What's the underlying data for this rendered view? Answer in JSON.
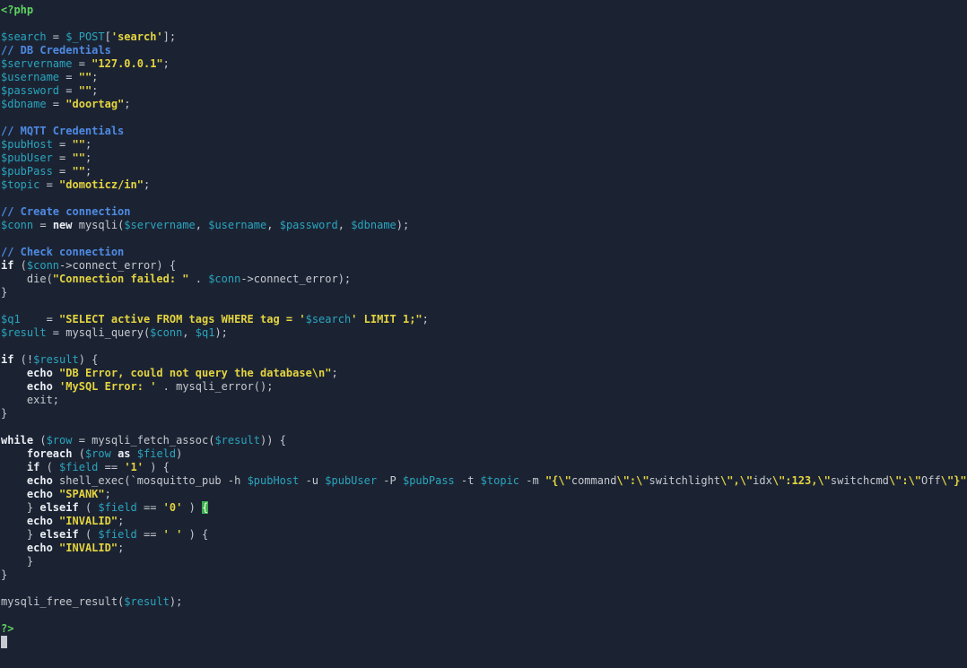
{
  "editor": {
    "colors": {
      "background": "#1b2333",
      "plain": "#c6c9cf",
      "variable": "#2aa5bd",
      "string": "#e4d43f",
      "keyword": "#eaeef3",
      "comment": "#4f8ae3",
      "php_tag": "#5fd35f",
      "bracket_highlight": "#3cb04a"
    },
    "lines": [
      [
        [
          "php",
          "<?php"
        ]
      ],
      [],
      [
        [
          "var",
          "$search"
        ],
        [
          "plain",
          " = "
        ],
        [
          "var",
          "$_POST"
        ],
        [
          "plain",
          "["
        ],
        [
          "str",
          "'search'"
        ],
        [
          "plain",
          "];"
        ]
      ],
      [
        [
          "cmt",
          "// DB Credentials"
        ]
      ],
      [
        [
          "var",
          "$servername"
        ],
        [
          "plain",
          " = "
        ],
        [
          "str",
          "\"127.0.0.1\""
        ],
        [
          "plain",
          ";"
        ]
      ],
      [
        [
          "var",
          "$username"
        ],
        [
          "plain",
          " = "
        ],
        [
          "str",
          "\"\""
        ],
        [
          "plain",
          ";"
        ]
      ],
      [
        [
          "var",
          "$password"
        ],
        [
          "plain",
          " = "
        ],
        [
          "str",
          "\"\""
        ],
        [
          "plain",
          ";"
        ]
      ],
      [
        [
          "var",
          "$dbname"
        ],
        [
          "plain",
          " = "
        ],
        [
          "str",
          "\"doortag\""
        ],
        [
          "plain",
          ";"
        ]
      ],
      [],
      [
        [
          "cmt",
          "// MQTT Credentials"
        ]
      ],
      [
        [
          "var",
          "$pubHost"
        ],
        [
          "plain",
          " = "
        ],
        [
          "str",
          "\"\""
        ],
        [
          "plain",
          ";"
        ]
      ],
      [
        [
          "var",
          "$pubUser"
        ],
        [
          "plain",
          " = "
        ],
        [
          "str",
          "\"\""
        ],
        [
          "plain",
          ";"
        ]
      ],
      [
        [
          "var",
          "$pubPass"
        ],
        [
          "plain",
          " = "
        ],
        [
          "str",
          "\"\""
        ],
        [
          "plain",
          ";"
        ]
      ],
      [
        [
          "var",
          "$topic"
        ],
        [
          "plain",
          " = "
        ],
        [
          "str",
          "\"domoticz/in\""
        ],
        [
          "plain",
          ";"
        ]
      ],
      [],
      [
        [
          "cmt",
          "// Create connection"
        ]
      ],
      [
        [
          "var",
          "$conn"
        ],
        [
          "plain",
          " = "
        ],
        [
          "kw",
          "new"
        ],
        [
          "plain",
          " mysqli("
        ],
        [
          "var",
          "$servername"
        ],
        [
          "plain",
          ", "
        ],
        [
          "var",
          "$username"
        ],
        [
          "plain",
          ", "
        ],
        [
          "var",
          "$password"
        ],
        [
          "plain",
          ", "
        ],
        [
          "var",
          "$dbname"
        ],
        [
          "plain",
          ");"
        ]
      ],
      [],
      [
        [
          "cmt",
          "// Check connection"
        ]
      ],
      [
        [
          "kw",
          "if"
        ],
        [
          "plain",
          " ("
        ],
        [
          "var",
          "$conn"
        ],
        [
          "plain",
          "->connect_error) {"
        ]
      ],
      [
        [
          "plain",
          "    die("
        ],
        [
          "str",
          "\"Connection failed: \""
        ],
        [
          "plain",
          " . "
        ],
        [
          "var",
          "$conn"
        ],
        [
          "plain",
          "->connect_error);"
        ]
      ],
      [
        [
          "plain",
          "}"
        ]
      ],
      [],
      [
        [
          "var",
          "$q1"
        ],
        [
          "plain",
          "    = "
        ],
        [
          "str",
          "\"SELECT active FROM tags WHERE tag = '"
        ],
        [
          "var",
          "$search"
        ],
        [
          "str",
          "' LIMIT 1;\""
        ],
        [
          "plain",
          ";"
        ]
      ],
      [
        [
          "var",
          "$result"
        ],
        [
          "plain",
          " = mysqli_query("
        ],
        [
          "var",
          "$conn"
        ],
        [
          "plain",
          ", "
        ],
        [
          "var",
          "$q1"
        ],
        [
          "plain",
          ");"
        ]
      ],
      [],
      [
        [
          "kw",
          "if"
        ],
        [
          "plain",
          " (!"
        ],
        [
          "var",
          "$result"
        ],
        [
          "plain",
          ") {"
        ]
      ],
      [
        [
          "plain",
          "    "
        ],
        [
          "kw",
          "echo"
        ],
        [
          "plain",
          " "
        ],
        [
          "str",
          "\"DB Error, could not query the database\\n\""
        ],
        [
          "plain",
          ";"
        ]
      ],
      [
        [
          "plain",
          "    "
        ],
        [
          "kw",
          "echo"
        ],
        [
          "plain",
          " "
        ],
        [
          "str",
          "'MySQL Error: '"
        ],
        [
          "plain",
          " . mysqli_error();"
        ]
      ],
      [
        [
          "plain",
          "    exit;"
        ]
      ],
      [
        [
          "plain",
          "}"
        ]
      ],
      [],
      [
        [
          "kw",
          "while"
        ],
        [
          "plain",
          " ("
        ],
        [
          "var",
          "$row"
        ],
        [
          "plain",
          " = mysqli_fetch_assoc("
        ],
        [
          "var",
          "$result"
        ],
        [
          "plain",
          ")) {"
        ]
      ],
      [
        [
          "plain",
          "    "
        ],
        [
          "kw",
          "foreach"
        ],
        [
          "plain",
          " ("
        ],
        [
          "var",
          "$row"
        ],
        [
          "plain",
          " "
        ],
        [
          "kw",
          "as"
        ],
        [
          "plain",
          " "
        ],
        [
          "var",
          "$field"
        ],
        [
          "plain",
          ")"
        ]
      ],
      [
        [
          "plain",
          "    "
        ],
        [
          "kw",
          "if"
        ],
        [
          "plain",
          " ( "
        ],
        [
          "var",
          "$field"
        ],
        [
          "plain",
          " == "
        ],
        [
          "str",
          "'1'"
        ],
        [
          "plain",
          " ) {"
        ]
      ],
      [
        [
          "plain",
          "    "
        ],
        [
          "kw",
          "echo"
        ],
        [
          "plain",
          " shell_exec(`mosquitto_pub -h "
        ],
        [
          "var",
          "$pubHost"
        ],
        [
          "plain",
          " -u "
        ],
        [
          "var",
          "$pubUser"
        ],
        [
          "plain",
          " -P "
        ],
        [
          "var",
          "$pubPass"
        ],
        [
          "plain",
          " -t "
        ],
        [
          "var",
          "$topic"
        ],
        [
          "plain",
          " -m "
        ],
        [
          "str",
          "\"{\\\""
        ],
        [
          "plain",
          "command"
        ],
        [
          "str",
          "\\\":\\\""
        ],
        [
          "plain",
          "switchlight"
        ],
        [
          "str",
          "\\\",\\\""
        ],
        [
          "plain",
          "idx"
        ],
        [
          "str",
          "\\\":123,\\\""
        ],
        [
          "plain",
          "switchcmd"
        ],
        [
          "str",
          "\\\":\\\""
        ],
        [
          "plain",
          "Off"
        ],
        [
          "str",
          "\\\"}\""
        ],
        [
          "plain",
          "`);"
        ]
      ],
      [
        [
          "plain",
          "    "
        ],
        [
          "kw",
          "echo"
        ],
        [
          "plain",
          " "
        ],
        [
          "str",
          "\"SPANK\""
        ],
        [
          "plain",
          ";"
        ]
      ],
      [
        [
          "plain",
          "    } "
        ],
        [
          "kw",
          "elseif"
        ],
        [
          "plain",
          " ( "
        ],
        [
          "var",
          "$field"
        ],
        [
          "plain",
          " == "
        ],
        [
          "str",
          "'0'"
        ],
        [
          "plain",
          " ) "
        ],
        [
          "hl",
          "{"
        ]
      ],
      [
        [
          "plain",
          "    "
        ],
        [
          "kw",
          "echo"
        ],
        [
          "plain",
          " "
        ],
        [
          "str",
          "\"INVALID\""
        ],
        [
          "plain",
          ";"
        ]
      ],
      [
        [
          "plain",
          "    } "
        ],
        [
          "kw",
          "elseif"
        ],
        [
          "plain",
          " ( "
        ],
        [
          "var",
          "$field"
        ],
        [
          "plain",
          " == "
        ],
        [
          "str",
          "' '"
        ],
        [
          "plain",
          " ) {"
        ]
      ],
      [
        [
          "plain",
          "    "
        ],
        [
          "kw",
          "echo"
        ],
        [
          "plain",
          " "
        ],
        [
          "str",
          "\"INVALID\""
        ],
        [
          "plain",
          ";"
        ]
      ],
      [
        [
          "plain",
          "    }"
        ]
      ],
      [
        [
          "plain",
          "}"
        ]
      ],
      [],
      [
        [
          "plain",
          "mysqli_free_result("
        ],
        [
          "var",
          "$result"
        ],
        [
          "plain",
          ");"
        ]
      ],
      [],
      [
        [
          "php",
          "?>"
        ]
      ],
      [
        [
          "cursor",
          ""
        ]
      ]
    ]
  }
}
